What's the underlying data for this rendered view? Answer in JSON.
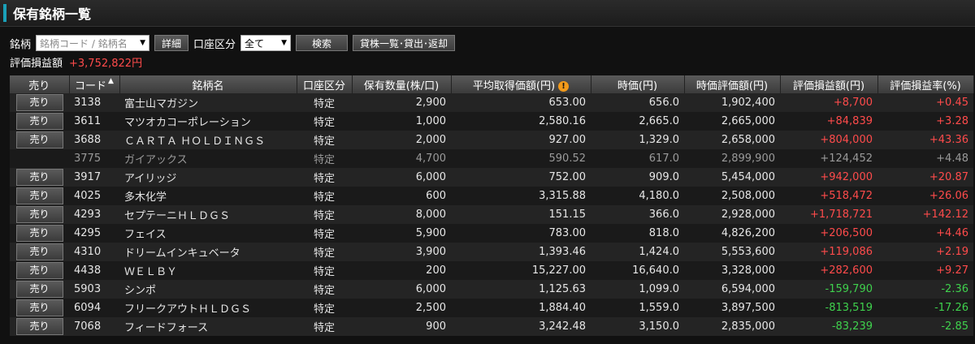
{
  "header": {
    "title": "保有銘柄一覧"
  },
  "filters": {
    "stock_label": "銘柄",
    "stock_placeholder": "銘柄コード / 銘柄名",
    "detail_button": "詳細",
    "account_label": "口座区分",
    "account_value": "全て",
    "search_button": "検索",
    "lending_button": "貸株一覧･貸出･返却"
  },
  "summary": {
    "label": "評価損益額",
    "value": "+3,752,822円"
  },
  "columns": [
    "売り",
    "コード",
    "銘柄名",
    "口座区分",
    "保有数量(株/口)",
    "平均取得価額(円)",
    "時価(円)",
    "時価評価額(円)",
    "評価損益額(円)",
    "評価損益率(%)"
  ],
  "sell_label": "売り",
  "colors": {
    "positive": "#ff4b4b",
    "negative": "#3fd14d",
    "accent": "#1aa0b8",
    "warning": "#f29a1b"
  },
  "rows": [
    {
      "sell": true,
      "code": "3138",
      "name": "富士山マガジン",
      "account": "特定",
      "qty": "2,900",
      "avg": "653.00",
      "price": "656.0",
      "value": "1,902,400",
      "pl": "+8,700",
      "rate": "+0.45"
    },
    {
      "sell": true,
      "code": "3611",
      "name": "マツオカコーポレーション",
      "account": "特定",
      "qty": "1,000",
      "avg": "2,580.16",
      "price": "2,665.0",
      "value": "2,665,000",
      "pl": "+84,839",
      "rate": "+3.28"
    },
    {
      "sell": true,
      "code": "3688",
      "name": "ＣＡＲＴＡ ＨＯＬＤＩＮＧＳ",
      "account": "特定",
      "qty": "2,000",
      "avg": "927.00",
      "price": "1,329.0",
      "value": "2,658,000",
      "pl": "+804,000",
      "rate": "+43.36"
    },
    {
      "sell": false,
      "code": "3775",
      "name": "ガイアックス",
      "account": "特定",
      "qty": "4,700",
      "avg": "590.52",
      "price": "617.0",
      "value": "2,899,900",
      "pl": "+124,452",
      "rate": "+4.48"
    },
    {
      "sell": true,
      "code": "3917",
      "name": "アイリッジ",
      "account": "特定",
      "qty": "6,000",
      "avg": "752.00",
      "price": "909.0",
      "value": "5,454,000",
      "pl": "+942,000",
      "rate": "+20.87"
    },
    {
      "sell": true,
      "code": "4025",
      "name": "多木化学",
      "account": "特定",
      "qty": "600",
      "avg": "3,315.88",
      "price": "4,180.0",
      "value": "2,508,000",
      "pl": "+518,472",
      "rate": "+26.06"
    },
    {
      "sell": true,
      "code": "4293",
      "name": "セプテーニＨＬＤＧＳ",
      "account": "特定",
      "qty": "8,000",
      "avg": "151.15",
      "price": "366.0",
      "value": "2,928,000",
      "pl": "+1,718,721",
      "rate": "+142.12"
    },
    {
      "sell": true,
      "code": "4295",
      "name": "フェイス",
      "account": "特定",
      "qty": "5,900",
      "avg": "783.00",
      "price": "818.0",
      "value": "4,826,200",
      "pl": "+206,500",
      "rate": "+4.46"
    },
    {
      "sell": true,
      "code": "4310",
      "name": "ドリームインキュベータ",
      "account": "特定",
      "qty": "3,900",
      "avg": "1,393.46",
      "price": "1,424.0",
      "value": "5,553,600",
      "pl": "+119,086",
      "rate": "+2.19"
    },
    {
      "sell": true,
      "code": "4438",
      "name": "ＷＥＬＢＹ",
      "account": "特定",
      "qty": "200",
      "avg": "15,227.00",
      "price": "16,640.0",
      "value": "3,328,000",
      "pl": "+282,600",
      "rate": "+9.27"
    },
    {
      "sell": true,
      "code": "5903",
      "name": "シンポ",
      "account": "特定",
      "qty": "6,000",
      "avg": "1,125.63",
      "price": "1,099.0",
      "value": "6,594,000",
      "pl": "-159,790",
      "rate": "-2.36"
    },
    {
      "sell": true,
      "code": "6094",
      "name": "フリークアウトＨＬＤＧＳ",
      "account": "特定",
      "qty": "2,500",
      "avg": "1,884.40",
      "price": "1,559.0",
      "value": "3,897,500",
      "pl": "-813,519",
      "rate": "-17.26"
    },
    {
      "sell": true,
      "code": "7068",
      "name": "フィードフォース",
      "account": "特定",
      "qty": "900",
      "avg": "3,242.48",
      "price": "3,150.0",
      "value": "2,835,000",
      "pl": "-83,239",
      "rate": "-2.85"
    }
  ]
}
